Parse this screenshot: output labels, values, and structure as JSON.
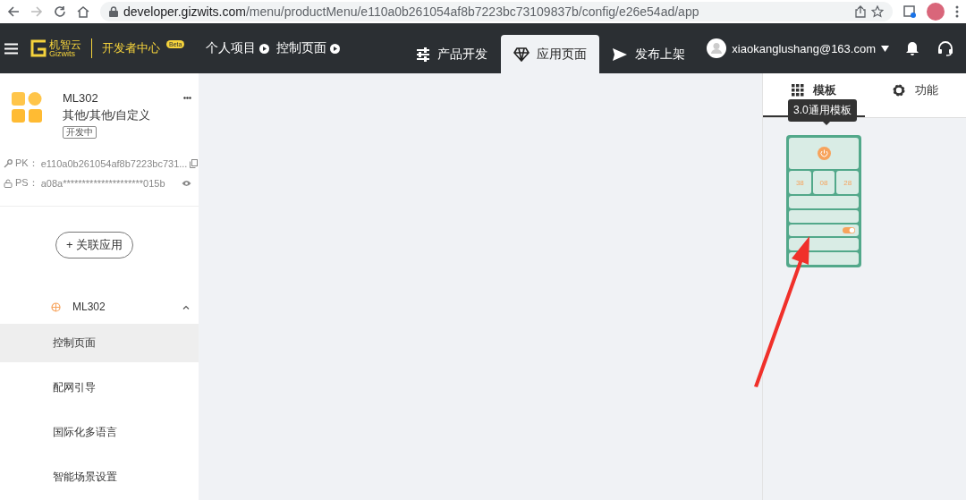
{
  "browser": {
    "url_host": "developer.gizwits.com",
    "url_path": "/menu/productMenu/e110a0b261054af8b7223bc73109837b/config/e26e54ad/app"
  },
  "header": {
    "logo_cn": "机智云",
    "logo_en": "Gizwits",
    "portal": "开发者中心",
    "badge": "Beta",
    "breadcrumbs": [
      "个人项目",
      "控制页面"
    ],
    "tabs": [
      {
        "label": "产品开发",
        "selected": false
      },
      {
        "label": "应用页面",
        "selected": true
      },
      {
        "label": "发布上架",
        "selected": false
      }
    ],
    "user": "xiaokanglushang@163.com"
  },
  "product": {
    "name": "ML302",
    "category": "其他/其他/自定义",
    "status": "开发中",
    "pk_label": "PK：",
    "pk": "e110a0b261054af8b7223bc731...",
    "ps_label": "PS：",
    "ps": "a08a*********************015b"
  },
  "link_button": "+ 关联应用",
  "app": {
    "name": "ML302",
    "expanded": true,
    "items": [
      {
        "label": "控制页面",
        "selected": true
      },
      {
        "label": "配网引导",
        "selected": false
      },
      {
        "label": "国际化多语言",
        "selected": false
      },
      {
        "label": "智能场景设置",
        "selected": false
      }
    ]
  },
  "panel": {
    "tabs": [
      {
        "label": "模板",
        "selected": true
      },
      {
        "label": "功能",
        "selected": false
      }
    ],
    "tooltip": "3.0通用模板",
    "template_values": [
      "38",
      "08",
      "28"
    ]
  }
}
